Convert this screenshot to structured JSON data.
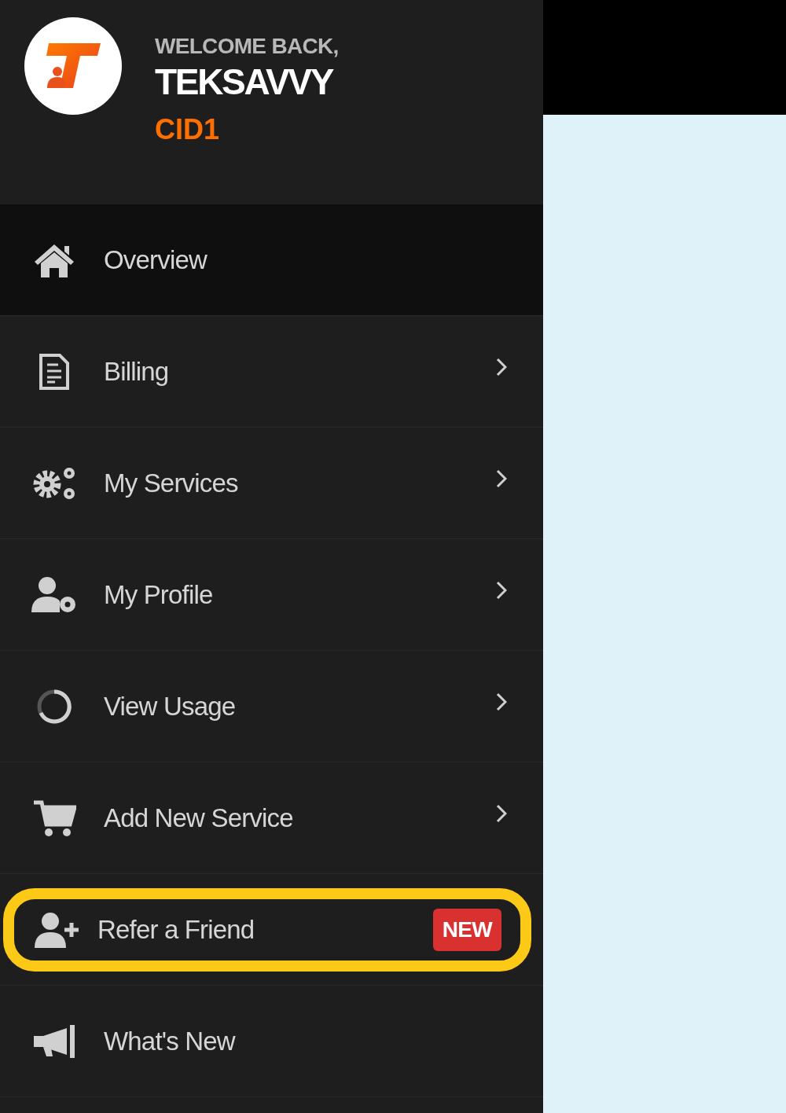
{
  "header": {
    "greeting": "WELCOME BACK,",
    "name": "TEKSAVVY",
    "customer_id": "CID1"
  },
  "menu": [
    {
      "label": "Overview",
      "selected": true,
      "chevron": false,
      "highlighted": false
    },
    {
      "label": "Billing",
      "selected": false,
      "chevron": true,
      "highlighted": false
    },
    {
      "label": "My Services",
      "selected": false,
      "chevron": true,
      "highlighted": false
    },
    {
      "label": "My Profile",
      "selected": false,
      "chevron": true,
      "highlighted": false
    },
    {
      "label": "View Usage",
      "selected": false,
      "chevron": true,
      "highlighted": false
    },
    {
      "label": "Add New Service",
      "selected": false,
      "chevron": true,
      "highlighted": false
    },
    {
      "label": "Refer a Friend",
      "selected": false,
      "chevron": false,
      "highlighted": true,
      "badge": "NEW"
    },
    {
      "label": "What's New",
      "selected": false,
      "chevron": false,
      "highlighted": false
    }
  ]
}
